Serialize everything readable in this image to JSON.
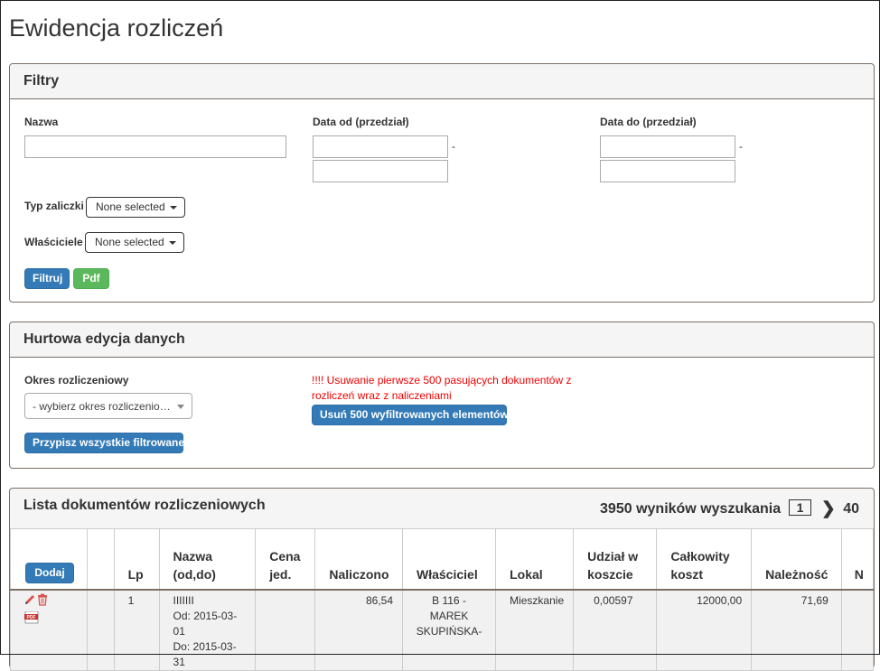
{
  "page": {
    "title": "Ewidencja rozliczeń"
  },
  "filters": {
    "heading": "Filtry",
    "name_label": "Nazwa",
    "date_from_label": "Data od (przedział)",
    "date_to_label": "Data do (przedział)",
    "range_dash": "-",
    "advance_type_label": "Typ zaliczki",
    "advance_type_value": "None selected",
    "owners_label": "Właściciele",
    "owners_value": "None selected",
    "filter_button": "Filtruj",
    "pdf_button": "Pdf"
  },
  "bulk_edit": {
    "heading": "Hurtowa edycja danych",
    "period_label": "Okres rozliczeniowy",
    "period_placeholder": "- wybierz okres rozliczenio…",
    "assign_button": "Przypisz wszystkie filtrowane",
    "warning": "!!!! Usuwanie pierwsze 500 pasujących dokumentów z rozliczeń wraz z naliczeniami",
    "delete_button": "Usuń 500 wyfiltrowanych elementów"
  },
  "documents": {
    "heading": "Lista dokumentów rozliczeniowych",
    "results_text": "3950 wyników wyszukania",
    "current_page": "1",
    "last_page": "40",
    "add_button": "Dodaj",
    "columns": {
      "lp": "Lp",
      "name": "Nazwa (od,do)",
      "unit_price": "Cena jed.",
      "charged": "Naliczono",
      "owner": "Właściciel",
      "unit": "Lokal",
      "share": "Udział w koszcie",
      "total_cost": "Całkowity koszt",
      "due": "Należność",
      "extra": "N"
    },
    "rows": [
      {
        "lp": "1",
        "name": "IIIIIII",
        "from": "Od: 2015-03-01",
        "to": "Do: 2015-03-31",
        "unit_price": "",
        "charged": "86,54",
        "owner": "B 116 - MAREK SKUPIŃSKA-",
        "unit": "Mieszkanie",
        "share": "0,00597",
        "total_cost": "12000,00",
        "due": "71,69"
      }
    ]
  },
  "colors": {
    "primary": "#337ab7",
    "success": "#5cb85c",
    "danger_text": "#ee0000",
    "delete_icon": "#d9534f"
  },
  "icons": {
    "edit": "edit-icon",
    "delete": "trash-icon",
    "pdf": "pdf-icon",
    "next": "chevron-right-icon"
  }
}
